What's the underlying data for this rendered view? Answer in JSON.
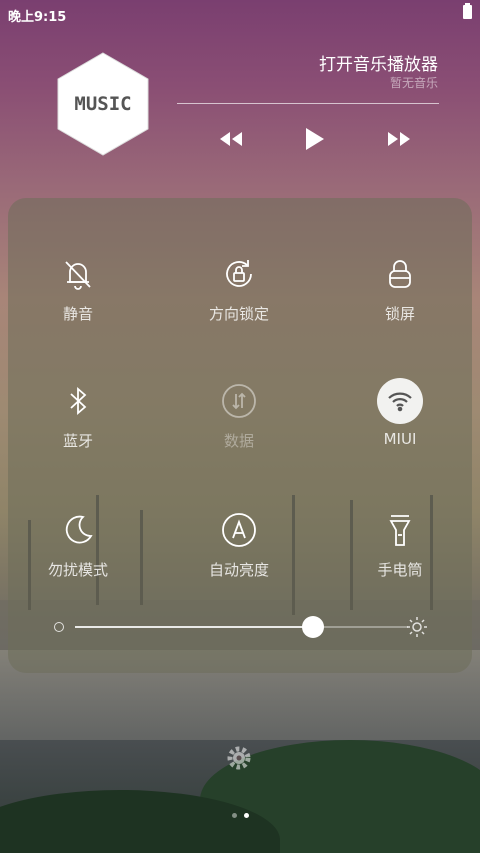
{
  "status": {
    "time": "晚上9:15"
  },
  "music": {
    "badge": "MUSIC",
    "title": "打开音乐播放器",
    "subtitle": "暂无音乐"
  },
  "tiles": [
    {
      "label": "静音",
      "icon": "bell-off-icon"
    },
    {
      "label": "方向锁定",
      "icon": "rotation-lock-icon"
    },
    {
      "label": "锁屏",
      "icon": "lock-icon"
    },
    {
      "label": "蓝牙",
      "icon": "bluetooth-icon"
    },
    {
      "label": "数据",
      "icon": "mobile-data-icon",
      "state": "disabled"
    },
    {
      "label": "MIUI",
      "icon": "wifi-icon",
      "state": "active"
    },
    {
      "label": "勿扰模式",
      "icon": "moon-icon"
    },
    {
      "label": "自动亮度",
      "icon": "auto-brightness-icon"
    },
    {
      "label": "手电筒",
      "icon": "flashlight-icon"
    }
  ],
  "brightness": {
    "level": 0.72
  },
  "pager": {
    "pages": 2,
    "current": 2
  },
  "colors": {
    "panel": "#6e6e5a",
    "active_tile": "#f2f2f0"
  }
}
